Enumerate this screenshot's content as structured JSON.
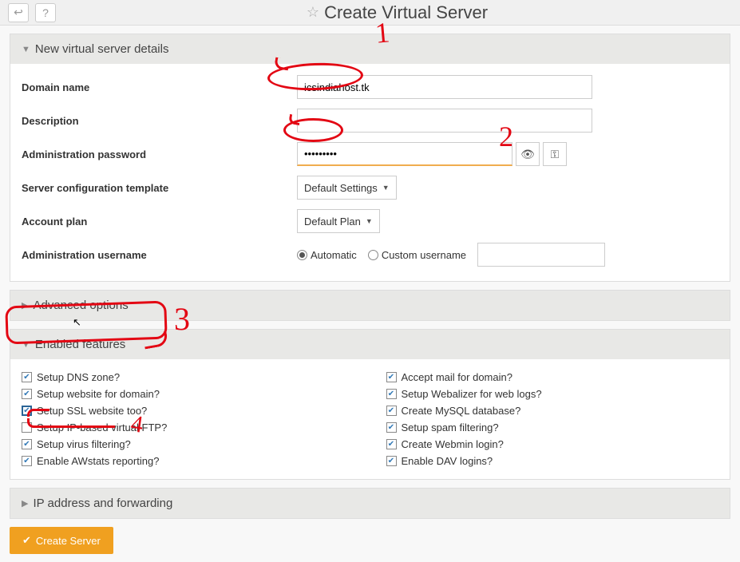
{
  "page_title": "Create Virtual Server",
  "sections": {
    "details": {
      "title": "New virtual server details",
      "domain_label": "Domain name",
      "domain_value": "icsindiahost.tk",
      "description_label": "Description",
      "description_value": "",
      "password_label": "Administration password",
      "password_value": "•••••••••",
      "template_label": "Server configuration template",
      "template_value": "Default Settings",
      "plan_label": "Account plan",
      "plan_value": "Default Plan",
      "username_label": "Administration username",
      "username_auto": "Automatic",
      "username_custom": "Custom username"
    },
    "advanced": {
      "title": "Advanced options"
    },
    "features": {
      "title": "Enabled features",
      "left": [
        {
          "label": "Setup DNS zone?",
          "checked": true
        },
        {
          "label": "Setup website for domain?",
          "checked": true
        },
        {
          "label": "Setup SSL website too?",
          "checked": true,
          "highlight": true
        },
        {
          "label": "Setup IP-based virtual FTP?",
          "checked": false
        },
        {
          "label": "Setup virus filtering?",
          "checked": true
        },
        {
          "label": "Enable AWstats reporting?",
          "checked": true
        }
      ],
      "right": [
        {
          "label": "Accept mail for domain?",
          "checked": true
        },
        {
          "label": "Setup Webalizer for web logs?",
          "checked": true
        },
        {
          "label": "Create MySQL database?",
          "checked": true
        },
        {
          "label": "Setup spam filtering?",
          "checked": true
        },
        {
          "label": "Create Webmin login?",
          "checked": true
        },
        {
          "label": "Enable DAV logins?",
          "checked": true
        }
      ]
    },
    "ip": {
      "title": "IP address and forwarding"
    }
  },
  "submit_label": "Create Server"
}
